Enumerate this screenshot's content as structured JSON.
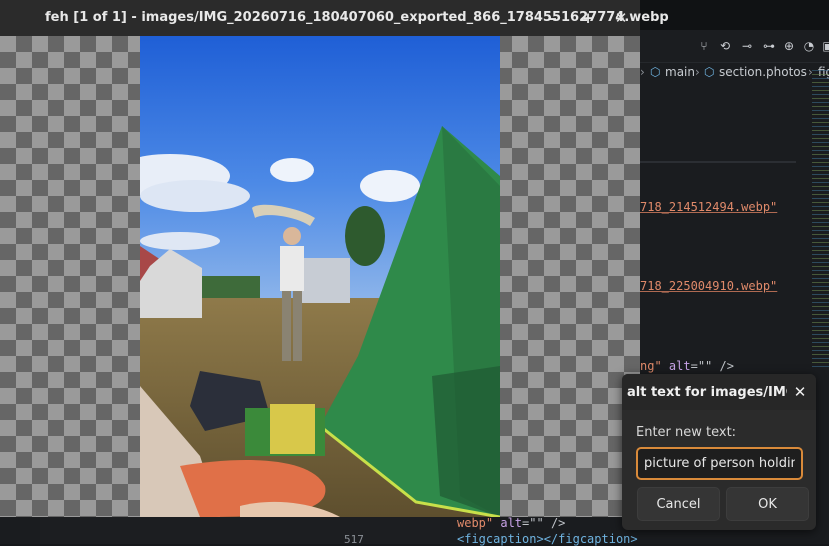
{
  "feh": {
    "title": "feh [1 of 1] - images/IMG_20260716_180407060_exported_866_1784551627774.webp",
    "minimize": "–",
    "maximize": "+",
    "close": "✕"
  },
  "editor": {
    "breadcrumb": [
      "main",
      "section.photos",
      "fig"
    ],
    "code_lines": [
      {
        "str": "718_214512494.webp\""
      },
      {
        "str": "718_225004910.webp\""
      },
      {
        "str": "ng\"",
        "attr": "alt",
        "rest": "=\"\" />"
      }
    ],
    "line_number": "517",
    "bottom_line_1": {
      "str": "webp\"",
      "attr": "alt",
      "rest": "=\"\" />"
    },
    "bottom_line_2": "<figcaption></figcaption>"
  },
  "dialog": {
    "title": "alt text for images/IMG_...",
    "close": "✕",
    "label": "Enter new text:",
    "value": "picture of person holding",
    "cancel": "Cancel",
    "ok": "OK"
  }
}
